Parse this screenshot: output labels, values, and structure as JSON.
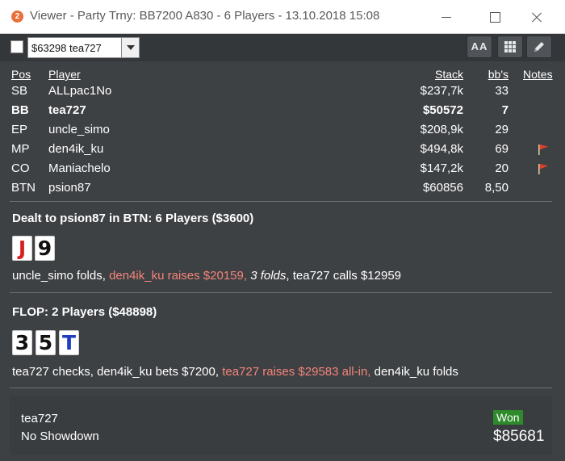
{
  "window": {
    "app_icon": "2",
    "title": "Viewer - Party Trny: BB7200 A830 - 6 Players - 13.10.2018 15:08"
  },
  "toolbar": {
    "selected_player": "$63298 tea727",
    "font_button_label": "AA",
    "grid_button_icon": "grid-icon",
    "edit_button_icon": "pencil-icon"
  },
  "players_table": {
    "headers": {
      "pos": "Pos",
      "player": "Player",
      "stack": "Stack",
      "bbs": "bb's",
      "notes": "Notes"
    },
    "rows": [
      {
        "pos": "SB",
        "player": "ALLpac1No",
        "stack": "$237,7k",
        "bbs": "33",
        "note_flag": false,
        "hero": false
      },
      {
        "pos": "BB",
        "player": "tea727",
        "stack": "$50572",
        "bbs": "7",
        "note_flag": false,
        "hero": true
      },
      {
        "pos": "EP",
        "player": "uncle_simo",
        "stack": "$208,9k",
        "bbs": "29",
        "note_flag": false,
        "hero": false
      },
      {
        "pos": "MP",
        "player": "den4ik_ku",
        "stack": "$494,8k",
        "bbs": "69",
        "note_flag": true,
        "hero": false
      },
      {
        "pos": "CO",
        "player": "Maniachelo",
        "stack": "$147,2k",
        "bbs": "20",
        "note_flag": true,
        "hero": false
      },
      {
        "pos": "BTN",
        "player": "psion87",
        "stack": "$60856",
        "bbs": "8,50",
        "note_flag": false,
        "hero": false
      }
    ]
  },
  "preflop": {
    "title": "Dealt to psion87 in BTN: 6 Players ($3600)",
    "cards": [
      {
        "rank": "J",
        "color": "#d42020"
      },
      {
        "rank": "9",
        "color": "#111111"
      }
    ],
    "actions": {
      "a1": "uncle_simo folds, ",
      "a2": "den4ik_ku raises $20159, ",
      "a3": "3 folds",
      "a4": ", tea727 calls $12959"
    }
  },
  "flop": {
    "title": "FLOP: 2 Players ($48898)",
    "cards": [
      {
        "rank": "3",
        "color": "#111111"
      },
      {
        "rank": "5",
        "color": "#111111"
      },
      {
        "rank": "T",
        "color": "#1f3fbf"
      }
    ],
    "actions": {
      "a1": "tea727 checks, den4ik_ku bets $7200, ",
      "a2": "tea727 raises $29583 all-in, ",
      "a3": "den4ik_ku folds"
    }
  },
  "result": {
    "player": "tea727",
    "showdown": "No Showdown",
    "badge": "Won",
    "amount": "$85681"
  },
  "colors": {
    "highlight_action": "#f4857a",
    "won_badge": "#2e8a2a",
    "note_flag": "#e0402a"
  }
}
